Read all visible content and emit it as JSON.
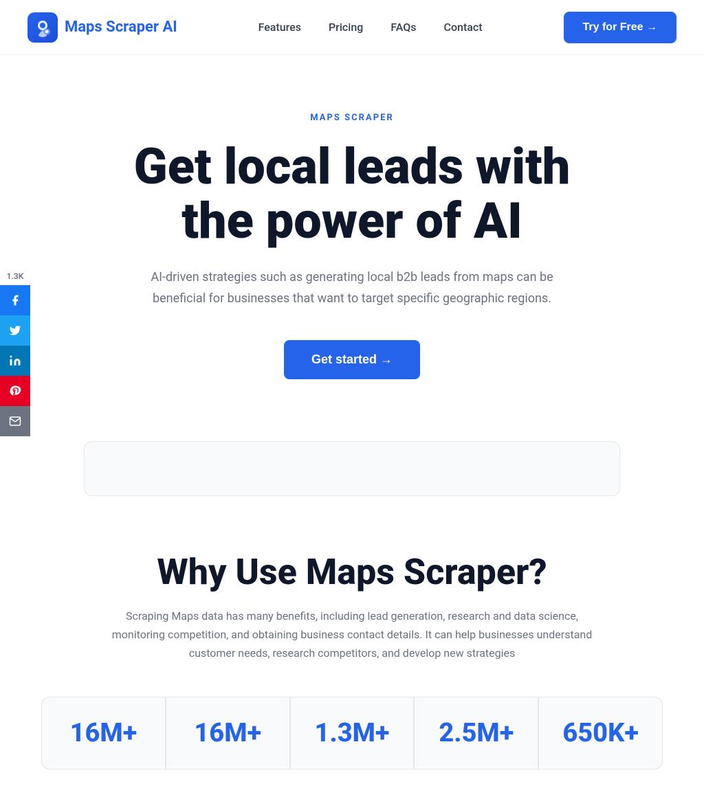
{
  "nav": {
    "logo_text": "Maps Scraper AI",
    "links": [
      {
        "label": "Features",
        "href": "#"
      },
      {
        "label": "Pricing",
        "href": "#"
      },
      {
        "label": "FAQs",
        "href": "#"
      },
      {
        "label": "Contact",
        "href": "#"
      }
    ],
    "cta_label": "Try for Free →"
  },
  "social": {
    "count": "1.3K",
    "items": [
      {
        "name": "facebook",
        "icon": "f",
        "label": "Share on Facebook"
      },
      {
        "name": "twitter",
        "icon": "t",
        "label": "Share on Twitter"
      },
      {
        "name": "linkedin",
        "icon": "in",
        "label": "Share on LinkedIn"
      },
      {
        "name": "pinterest",
        "icon": "p",
        "label": "Share on Pinterest"
      },
      {
        "name": "email",
        "icon": "@",
        "label": "Share via Email"
      }
    ]
  },
  "hero": {
    "badge": "MAPS SCRAPER",
    "title_line1": "Get local leads with",
    "title_line2": "the power of AI",
    "subtitle": "AI-driven strategies such as generating local b2b leads from maps can be beneficial for businesses that want to target specific geographic regions.",
    "cta_label": "Get started →"
  },
  "why": {
    "title": "Why Use Maps Scraper?",
    "subtitle": "Scraping Maps data has many benefits, including lead generation, research and data science, monitoring competition, and obtaining business contact details. It can help businesses understand customer needs, research competitors, and develop new strategies"
  },
  "stats": [
    {
      "number": "16M+",
      "label": ""
    },
    {
      "number": "16M+",
      "label": ""
    },
    {
      "number": "1.3M+",
      "label": ""
    },
    {
      "number": "2.5M+",
      "label": ""
    },
    {
      "number": "650K+",
      "label": ""
    }
  ]
}
